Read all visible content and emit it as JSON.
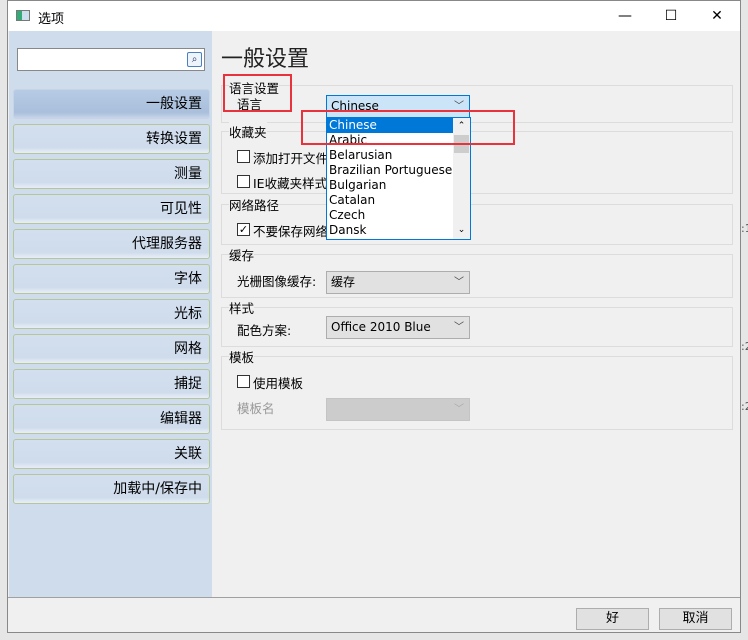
{
  "window": {
    "title": "选项",
    "minimize": "—",
    "maximize": "☐",
    "close": "✕"
  },
  "sidebar": {
    "search_placeholder": "",
    "items": [
      {
        "label": "一般设置",
        "selected": true
      },
      {
        "label": "转换设置"
      },
      {
        "label": "测量"
      },
      {
        "label": "可见性"
      },
      {
        "label": "代理服务器"
      },
      {
        "label": "字体"
      },
      {
        "label": "光标"
      },
      {
        "label": "网格"
      },
      {
        "label": "捕捉"
      },
      {
        "label": "编辑器"
      },
      {
        "label": "关联"
      },
      {
        "label": "加载中/保存中"
      }
    ]
  },
  "main": {
    "title": "一般设置",
    "language": {
      "group": "语言设置",
      "label": "语言",
      "value": "Chinese",
      "options": [
        "Chinese",
        "Arabic",
        "Belarusian",
        "Brazilian Portuguese",
        "Bulgarian",
        "Catalan",
        "Czech",
        "Dansk"
      ]
    },
    "favorites": {
      "group": "收藏夹",
      "add_open_file": "添加打开文件",
      "ie_style": "IE收藏夹样式"
    },
    "network": {
      "group": "网络路径",
      "dont_save": "不要保存网络"
    },
    "cache": {
      "group": "缓存",
      "label": "光栅图像缓存:",
      "value": "缓存"
    },
    "style": {
      "group": "样式",
      "label": "配色方案:",
      "value": "Office 2010 Blue"
    },
    "template": {
      "group": "模板",
      "use_template": "使用模板",
      "name_label": "模板名",
      "name_value": ""
    }
  },
  "footer": {
    "ok": "好",
    "cancel": "取消"
  },
  "colors": {
    "sidebar": "#cfdcec",
    "selected_item": "#a9bfdb",
    "highlight": "#0078d7",
    "annotation": "#e8323c"
  }
}
